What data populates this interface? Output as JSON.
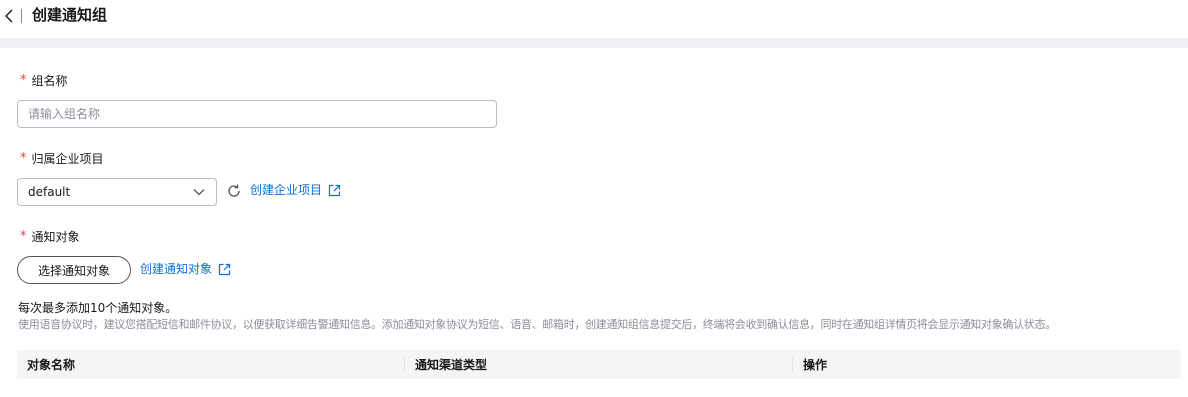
{
  "header": {
    "title": "创建通知组"
  },
  "form": {
    "group_name": {
      "required_mark": "*",
      "label": "组名称",
      "placeholder": "请输入组名称",
      "value": ""
    },
    "enterprise_project": {
      "required_mark": "*",
      "label": "归属企业项目",
      "selected": "default",
      "create_link": "创建企业项目"
    },
    "notify_target": {
      "required_mark": "*",
      "label": "通知对象",
      "select_button": "选择通知对象",
      "create_link": "创建通知对象"
    }
  },
  "hint": {
    "title": "每次最多添加10个通知对象。",
    "body": "使用语音协议时，建议您搭配短信和邮件协议，以便获取详细告警通知信息。添加通知对象协议为短信、语音、邮箱时，创建通知组信息提交后，终端将会收到确认信息，同时在通知组详情页将会显示通知对象确认状态。"
  },
  "table": {
    "columns": [
      "对象名称",
      "通知渠道类型",
      "操作"
    ]
  },
  "colors": {
    "link": "#0d6fd8",
    "required": "#e54545",
    "band": "#eff0f5",
    "table_header": "#f5f5f6"
  },
  "icons": {
    "back": "chevron-left-icon",
    "dropdown": "chevron-down-icon",
    "refresh": "refresh-icon",
    "external": "external-link-icon"
  }
}
